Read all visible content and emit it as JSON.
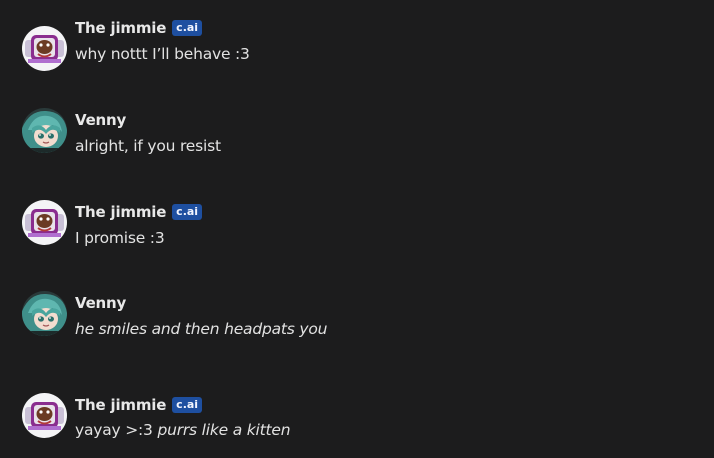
{
  "messages": [
    {
      "author": "The jimmie",
      "badge": "c.ai",
      "avatar_icon": "jimmie-avatar-icon",
      "text": "why nottt I’ll behave :3",
      "italic": ""
    },
    {
      "author": "Venny",
      "badge": "",
      "avatar_icon": "venny-avatar-icon",
      "text": "alright, if you resist",
      "italic": ""
    },
    {
      "author": "The jimmie",
      "badge": "c.ai",
      "avatar_icon": "jimmie-avatar-icon",
      "text": "I promise :3",
      "italic": ""
    },
    {
      "author": "Venny",
      "badge": "",
      "avatar_icon": "venny-avatar-icon",
      "text": "",
      "italic": "he smiles and then headpats you"
    },
    {
      "author": "The jimmie",
      "badge": "c.ai",
      "avatar_icon": "jimmie-avatar-icon",
      "text": "yayay >:3 ",
      "italic": "purrs like a kitten"
    }
  ],
  "colors": {
    "background": "#1c1c1d",
    "badge": "#1e4fa0",
    "text": "#e2e2e2"
  }
}
